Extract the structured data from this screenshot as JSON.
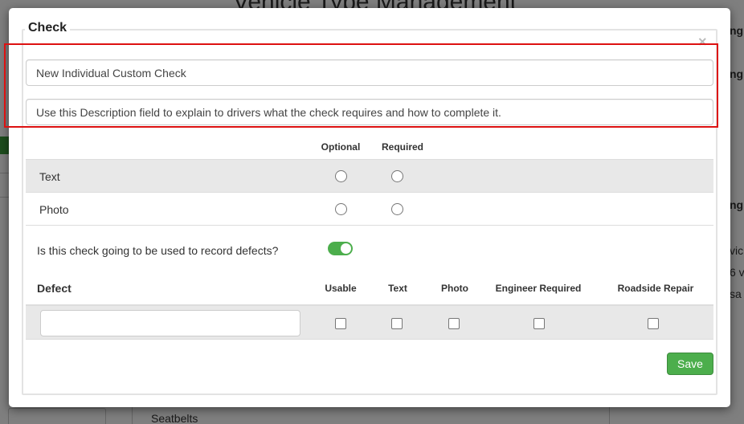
{
  "background": {
    "title": "Vehicle Type Management",
    "right_texts": [
      "ng",
      "ng",
      "ng",
      "vic",
      "6 v",
      "sa"
    ],
    "bottom_text": "Seatbelts"
  },
  "modal": {
    "legend": "Check",
    "close_symbol": "×",
    "name_value": "New Individual Custom Check",
    "description_value": "Use this Description field to explain to drivers what the check requires and how to complete it.",
    "columns": {
      "optional": "Optional",
      "required": "Required"
    },
    "rows": [
      {
        "label": "Text"
      },
      {
        "label": "Photo"
      }
    ],
    "defect_question": "Is this check going to be used to record defects?",
    "defect_toggle_on": true,
    "defect_table": {
      "title": "Defect",
      "headers": [
        "Usable",
        "Text",
        "Photo",
        "Engineer Required",
        "Roadside Repair"
      ]
    },
    "save_label": "Save"
  },
  "colors": {
    "highlight": "#dd1111",
    "accent_green": "#4cae4c"
  }
}
